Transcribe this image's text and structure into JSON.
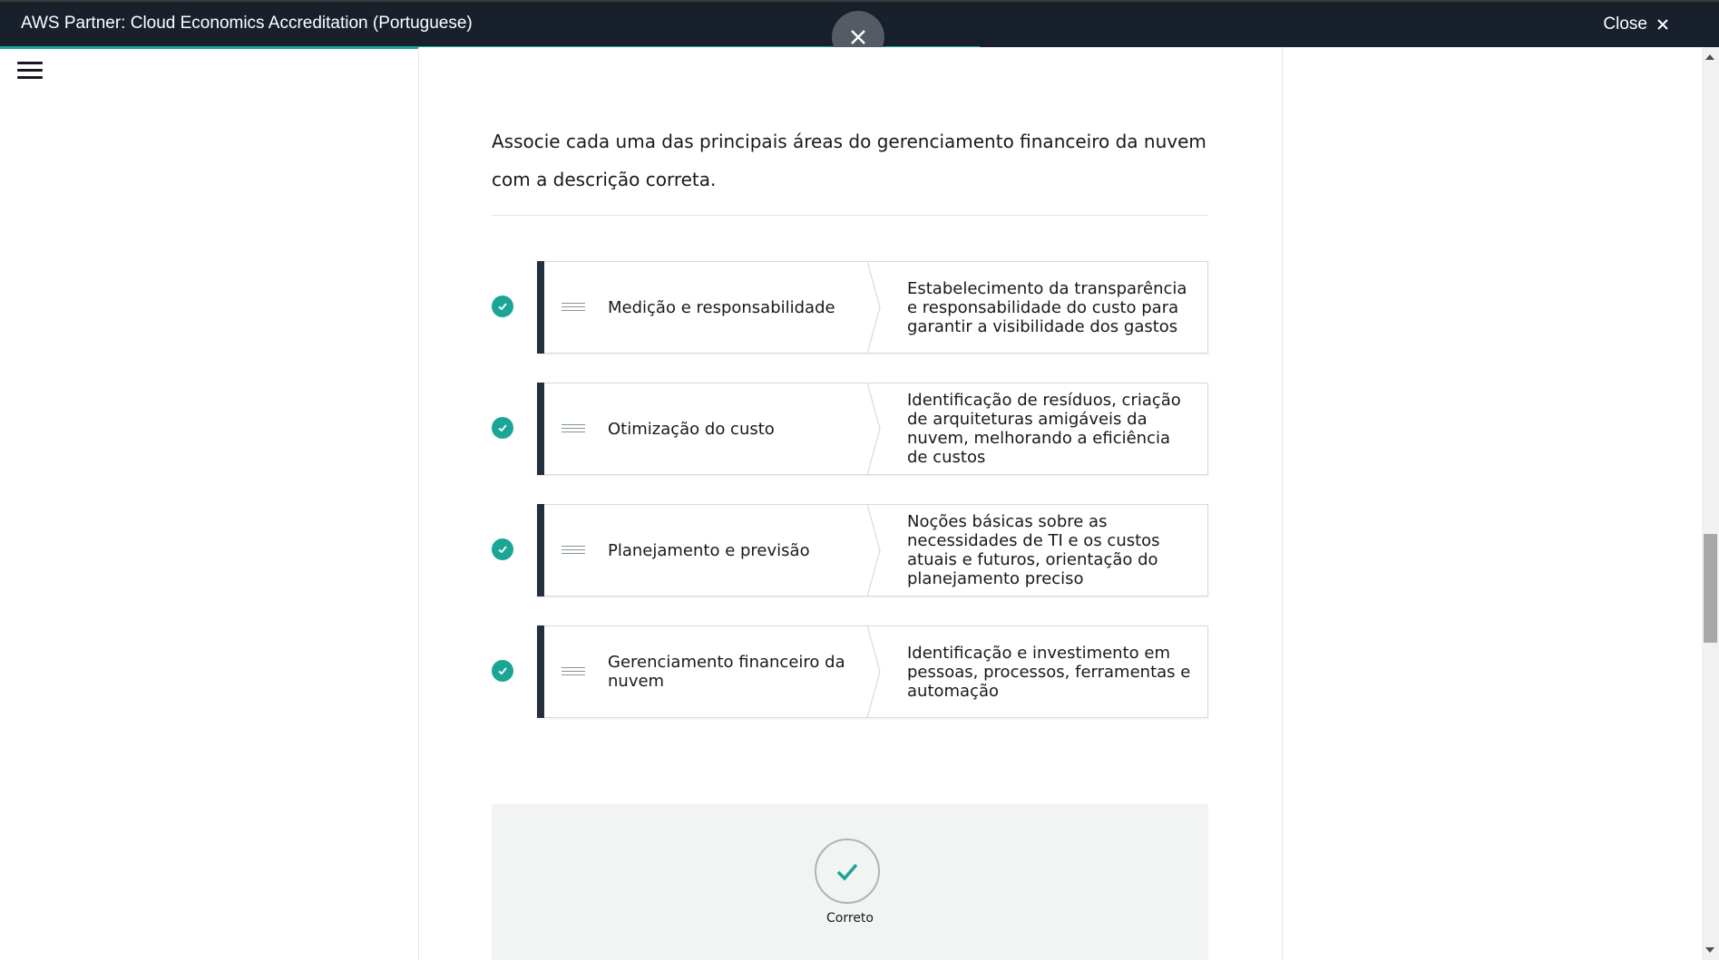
{
  "header": {
    "title": "AWS Partner: Cloud Economics Accreditation (Portuguese)",
    "close_label": "Close",
    "progress_fraction": 0.57
  },
  "icons": {
    "menu": "hamburger-menu-icon",
    "close": "close-icon",
    "check": "check-icon",
    "grip": "drag-handle-icon"
  },
  "question": {
    "text": "Associe cada uma das principais áreas do gerenciamento financeiro da nuvem com a descrição correta."
  },
  "matches": [
    {
      "term": "Medição e responsabilidade",
      "description": "Estabelecimento da transparência e responsabilidade do custo para garantir a visibilidade dos gastos"
    },
    {
      "term": "Otimização do custo",
      "description": "Identificação de resíduos, criação de arquiteturas amigáveis da nuvem, melhorando a eficiência de custos"
    },
    {
      "term": "Planejamento e previsão",
      "description": "Noções básicas sobre as necessidades de TI e os custos atuais e futuros, orientação do planejamento preciso"
    },
    {
      "term": "Gerenciamento financeiro da nuvem",
      "description": "Identificação e investimento em pessoas, processos, ferramentas e automação"
    }
  ],
  "feedback": {
    "label": "Correto"
  },
  "colors": {
    "topbar": "#17202b",
    "accent": "#1aa596",
    "item_bar": "#232f3e"
  }
}
